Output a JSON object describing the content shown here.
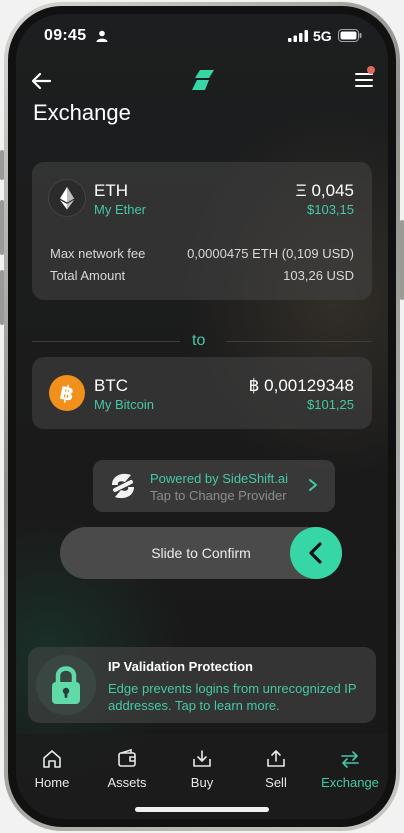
{
  "status_bar": {
    "time": "09:45",
    "network": "5G"
  },
  "header": {
    "title": "Exchange"
  },
  "from": {
    "code": "ETH",
    "wallet": "My Ether",
    "amount": "Ξ 0,045",
    "fiat": "$103,15",
    "fee_label": "Max network fee",
    "fee_value": "0,0000475 ETH (0,109 USD)",
    "total_label": "Total Amount",
    "total_value": "103,26 USD"
  },
  "to_label": "to",
  "to": {
    "code": "BTC",
    "wallet": "My Bitcoin",
    "amount": "฿ 0,00129348",
    "fiat": "$101,25"
  },
  "provider": {
    "line1": "Powered by SideShift.ai",
    "line2": "Tap to Change Provider"
  },
  "slider": {
    "label": "Slide to Confirm"
  },
  "ip_protection": {
    "title": "IP Validation Protection",
    "body": "Edge prevents logins from unrecognized IP addresses. Tap to learn more."
  },
  "tabs": [
    {
      "label": "Home",
      "icon": "home-icon"
    },
    {
      "label": "Assets",
      "icon": "wallet-icon"
    },
    {
      "label": "Buy",
      "icon": "buy-icon"
    },
    {
      "label": "Sell",
      "icon": "sell-icon"
    },
    {
      "label": "Exchange",
      "icon": "exchange-icon",
      "active": true
    }
  ],
  "colors": {
    "accent": "#45c8a6",
    "knob": "#37d6a6",
    "eth": "#2b2b2b",
    "btc": "#f2901c"
  }
}
